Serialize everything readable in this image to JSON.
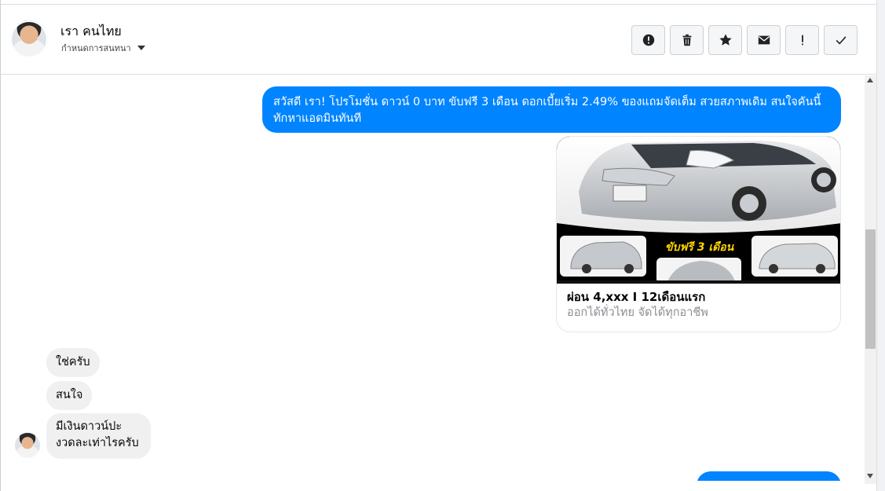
{
  "header": {
    "contact_name": "เรา คนไทย",
    "conversation_settings": "กำหนดการสนทนา"
  },
  "actions": [
    {
      "name": "report-button",
      "icon": "alert-circle-icon"
    },
    {
      "name": "delete-button",
      "icon": "trash-icon"
    },
    {
      "name": "star-button",
      "icon": "star-icon"
    },
    {
      "name": "mark-unread-button",
      "icon": "envelope-icon"
    },
    {
      "name": "important-button",
      "icon": "exclamation-icon"
    },
    {
      "name": "mark-done-button",
      "icon": "checkmark-icon"
    }
  ],
  "messages": {
    "outgoing_1": "สวัสดี เรา! โปรโมชั่น ดาวน์ 0 บาท ขับฟรี 3 เดือน ดอกเบี้ยเริ่ม 2.49% ของแถมจัดเต็ม สวยสภาพเดิม สนใจคันนี้ ทักหาแอดมินทันที",
    "card": {
      "banner_text": "ขับฟรี 3 เดือน",
      "title": "ผ่อน 4,xxx I 12เดือนแรก",
      "subtitle": "ออกได้ทั่วไทย จัดได้ทุกอาชีพ"
    },
    "incoming": [
      "ใช่ครับ",
      "สนใจ",
      "มีเงินดาวน์ปะ",
      "งวดละเท่าไรครับ"
    ]
  },
  "colors": {
    "outgoing_bubble": "#0084ff",
    "incoming_bubble": "#f0f0f0",
    "banner_text": "#ffd400"
  }
}
